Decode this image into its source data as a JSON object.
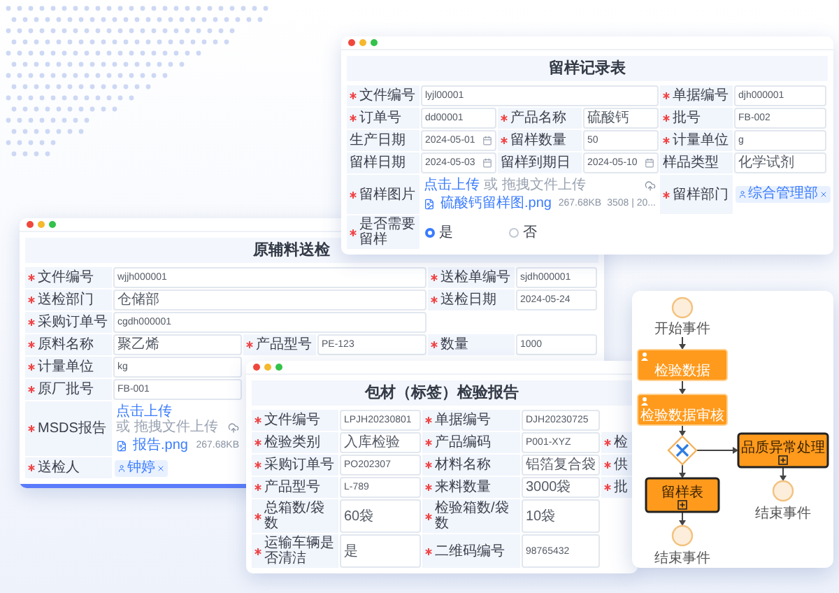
{
  "windows": [
    {
      "kind": "form",
      "title": "留样记录表",
      "rows": [
        [
          {
            "label": "文件编号",
            "required": true,
            "kind": "text",
            "value": "lyjl00001"
          },
          {
            "label": "单据编号",
            "required": true,
            "kind": "text",
            "value": "djh000001"
          }
        ],
        [
          {
            "label": "订单号",
            "required": true,
            "kind": "text",
            "value": "dd00001"
          },
          {
            "label": "产品名称",
            "required": true,
            "kind": "text",
            "value": "硫酸钙"
          },
          {
            "label": "批号",
            "required": true,
            "kind": "text",
            "value": "FB-002"
          }
        ],
        [
          {
            "label": "生产日期",
            "required": false,
            "kind": "date",
            "value": "2024-05-01"
          },
          {
            "label": "留样数量",
            "required": true,
            "kind": "text",
            "value": "50"
          },
          {
            "label": "计量单位",
            "required": true,
            "kind": "text",
            "value": "g"
          }
        ],
        [
          {
            "label": "留样日期",
            "required": false,
            "kind": "date",
            "value": "2024-05-03"
          },
          {
            "label": "留样到期日",
            "required": false,
            "kind": "date",
            "value": "2024-05-10"
          },
          {
            "label": "样品类型",
            "required": false,
            "kind": "text",
            "value": "化学试剂"
          }
        ],
        [
          {
            "label": "留样图片",
            "required": true,
            "kind": "upload",
            "link": "点击上传",
            "hint": "或 拖拽文件上传",
            "file": "硫酸钙留样图.png",
            "size": "267.68KB",
            "extra": "3508 | 20..."
          },
          {
            "label": "留样部门",
            "required": true,
            "kind": "tag",
            "value": "综合管理部"
          }
        ],
        [
          {
            "label": "是否需要留样",
            "required": true,
            "kind": "radio",
            "options": [
              {
                "label": "是",
                "selected": true
              },
              {
                "label": "否",
                "selected": false
              }
            ]
          }
        ]
      ]
    },
    {
      "kind": "form",
      "title": "原辅料送检",
      "rows": [
        [
          {
            "label": "文件编号",
            "required": true,
            "kind": "text",
            "value": "wjjh000001"
          },
          {
            "label": "送检单编号",
            "required": true,
            "kind": "text",
            "value": "sjdh000001"
          }
        ],
        [
          {
            "label": "送检部门",
            "required": true,
            "kind": "text",
            "value": "仓储部"
          },
          {
            "label": "送检日期",
            "required": true,
            "kind": "text",
            "value": "2024-05-24"
          }
        ],
        [
          {
            "label": "采购订单号",
            "required": true,
            "kind": "text",
            "value": "cgdh000001"
          }
        ],
        [
          {
            "label": "原料名称",
            "required": true,
            "kind": "text",
            "value": "聚乙烯"
          },
          {
            "label": "产品型号",
            "required": true,
            "kind": "text",
            "value": "PE-123"
          },
          {
            "label": "数量",
            "required": true,
            "kind": "text",
            "value": "1000"
          }
        ],
        [
          {
            "label": "计量单位",
            "required": true,
            "kind": "text",
            "value": "kg"
          }
        ],
        [
          {
            "label": "原厂批号",
            "required": true,
            "kind": "text",
            "value": "FB-001"
          }
        ],
        [
          {
            "label": "MSDS报告",
            "required": true,
            "kind": "upload",
            "link": "点击上传",
            "hint": "或 拖拽文件上传",
            "file": "报告.png",
            "size": "267.68KB"
          }
        ],
        [
          {
            "label": "送检人",
            "required": true,
            "kind": "tag",
            "value": "钟婷"
          }
        ]
      ]
    },
    {
      "kind": "form",
      "title": "包材（标签）检验报告",
      "rows": [
        [
          {
            "label": "文件编号",
            "required": true,
            "kind": "text",
            "value": "LPJH20230801"
          },
          {
            "label": "单据编号",
            "required": true,
            "kind": "text",
            "value": "DJH20230725"
          }
        ],
        [
          {
            "label": "检验类别",
            "required": true,
            "kind": "text",
            "value": "入库检验"
          },
          {
            "label": "产品编码",
            "required": true,
            "kind": "text",
            "value": "P001-XYZ"
          },
          {
            "label": "检",
            "required": true,
            "kind": "cut"
          }
        ],
        [
          {
            "label": "采购订单号",
            "required": true,
            "kind": "text",
            "value": "PO202307"
          },
          {
            "label": "材料名称",
            "required": true,
            "kind": "text",
            "value": "铝箔复合袋"
          },
          {
            "label": "供",
            "required": true,
            "kind": "cut"
          }
        ],
        [
          {
            "label": "产品型号",
            "required": true,
            "kind": "text",
            "value": "L-789"
          },
          {
            "label": "来料数量",
            "required": true,
            "kind": "text",
            "value": "3000袋"
          },
          {
            "label": "批",
            "required": true,
            "kind": "cut"
          }
        ],
        [
          {
            "label": "总箱数/袋数",
            "required": true,
            "kind": "text",
            "value": "60袋"
          },
          {
            "label": "检验箱数/袋数",
            "required": true,
            "kind": "text",
            "value": "10袋"
          }
        ],
        [
          {
            "label": "运输车辆是否清洁",
            "required": true,
            "kind": "text",
            "value": "是"
          },
          {
            "label": "二维码编号",
            "required": true,
            "kind": "text",
            "value": "98765432"
          }
        ]
      ]
    },
    {
      "kind": "flow",
      "nodes": [
        {
          "kind": "start",
          "label": "开始事件"
        },
        {
          "kind": "task",
          "label": "检验数据"
        },
        {
          "kind": "task",
          "label": "检验数据审核"
        },
        {
          "kind": "gateway"
        },
        {
          "kind": "subprocess",
          "label": "品质异常处理"
        },
        {
          "kind": "end",
          "label": "结束事件"
        },
        {
          "kind": "subprocess",
          "label": "留样表"
        },
        {
          "kind": "end",
          "label": "结束事件"
        }
      ]
    }
  ]
}
